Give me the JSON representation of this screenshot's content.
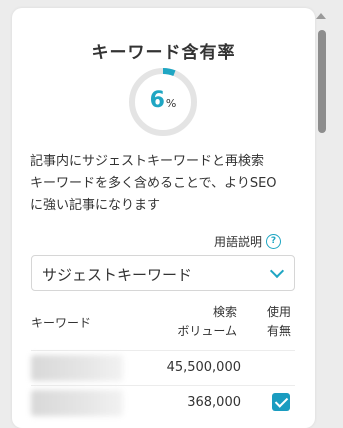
{
  "panel": {
    "title": "キーワード含有率",
    "ratio": {
      "value": "6",
      "unit": "%",
      "fraction": 0.06,
      "accent_color": "#1fa6c3",
      "track_color": "#e4e4e4"
    },
    "description_lines": [
      "記事内にサジェストキーワードと再検索",
      "キーワードを多く含めることで、よりSEO",
      "に強い記事になります"
    ],
    "terms_link": "用語説明",
    "help_icon": "question-circle-icon",
    "select": {
      "value": "サジェストキーワード",
      "icon": "chevron-down-icon"
    },
    "table": {
      "headers": {
        "keyword": "キーワード",
        "volume_line1": "検索",
        "volume_line2": "ボリューム",
        "used_line1": "使用",
        "used_line2": "有無"
      },
      "rows": [
        {
          "volume": "45,500,000",
          "used": false
        },
        {
          "volume": "368,000",
          "used": true
        }
      ]
    }
  }
}
